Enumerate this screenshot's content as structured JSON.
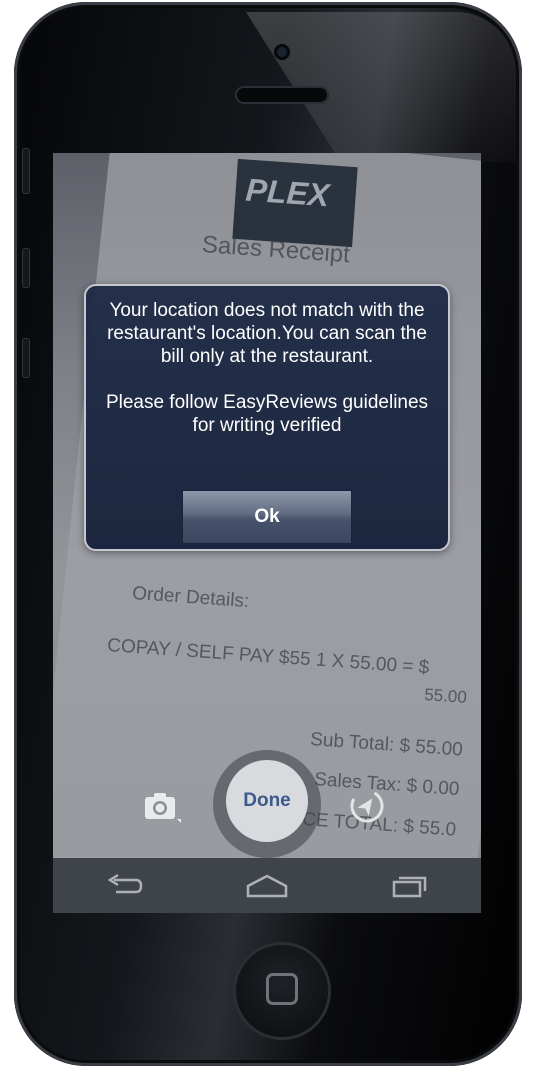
{
  "receipt": {
    "logo": "PLEX",
    "title": "Sales Receipt",
    "order_details": "Order Details:",
    "copay_line": "COPAY / SELF PAY $55  1 X 55.00 = $",
    "amount": "55.00",
    "sub_total": "Sub Total: $ 55.00",
    "sales_tax": "Sales Tax: $ 0.00",
    "invoice_total": "CE TOTAL: $ 55.0"
  },
  "dialog": {
    "message": "Your location does not match with the restaurant's location.You can scan the bill only at the restaurant.",
    "guidelines": "Please follow EasyReviews guidelines for writing verified",
    "ok_label": "Ok"
  },
  "camera": {
    "done_label": "Done",
    "camera_icon": "camera-icon",
    "location_icon": "location-pin-icon"
  },
  "navbar": {
    "back_icon": "back-icon",
    "home_icon": "home-icon",
    "recents_icon": "recent-apps-icon"
  },
  "colors": {
    "dialog_bg": "#1e2a46",
    "done_text": "#3a5b8c",
    "navbar_bg": "#3f444b"
  }
}
